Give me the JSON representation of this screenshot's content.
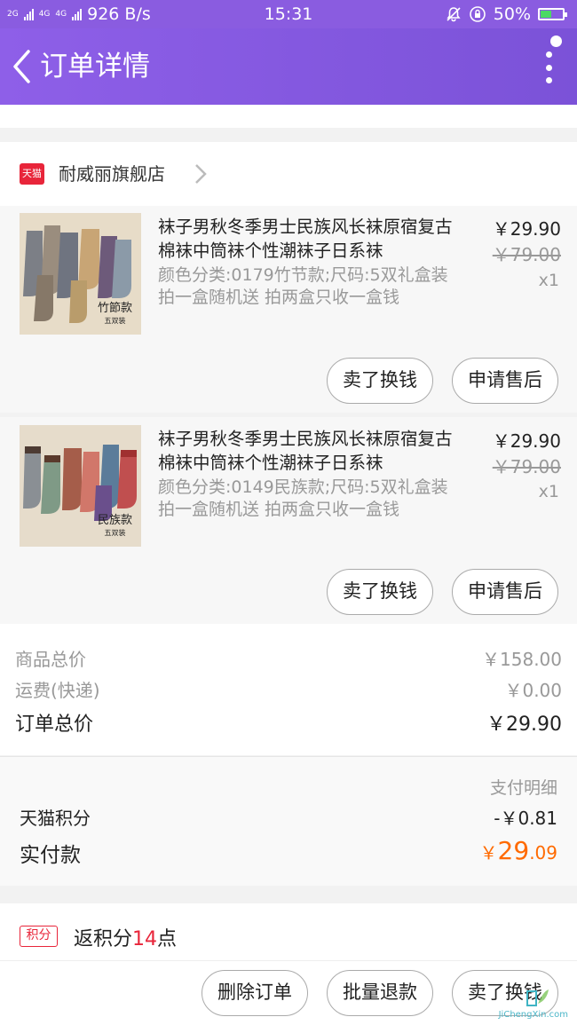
{
  "status": {
    "sig1": "2G",
    "sig2": "4G",
    "sig3": "4G",
    "speed": "926 B/s",
    "time": "15:31",
    "battery": "50%",
    "battery_level": 0.5
  },
  "header": {
    "title": "订单详情"
  },
  "shop": {
    "badge": "天猫",
    "name": "耐威丽旗舰店"
  },
  "items": [
    {
      "title": "袜子男秋冬季男士民族风长袜原宿复古棉袜中筒袜个性潮袜子日系袜",
      "spec": "颜色分类:0179竹节款;尺码:5双礼盒装 拍一盒随机送 拍两盒只收一盒钱",
      "price": "￥29.90",
      "original_price": "￥79.00",
      "qty": "x1",
      "thumb_label": "竹節款",
      "thumb_sub": "五双装",
      "btn_exchange": "卖了换钱",
      "btn_aftersale": "申请售后"
    },
    {
      "title": "袜子男秋冬季男士民族风长袜原宿复古棉袜中筒袜个性潮袜子日系袜",
      "spec": "颜色分类:0149民族款;尺码:5双礼盒装 拍一盒随机送 拍两盒只收一盒钱",
      "price": "￥29.90",
      "original_price": "￥79.00",
      "qty": "x1",
      "thumb_label": "民族款",
      "thumb_sub": "五双装",
      "btn_exchange": "卖了换钱",
      "btn_aftersale": "申请售后"
    }
  ],
  "summary": {
    "goods_label": "商品总价",
    "goods_value": "￥158.00",
    "shipping_label": "运费(快递)",
    "shipping_value": "￥0.00",
    "total_label": "订单总价",
    "total_value": "￥29.90"
  },
  "payment": {
    "detail_label": "支付明细",
    "points_label": "天猫积分",
    "points_value": "-￥0.81",
    "paid_label": "实付款",
    "paid_currency": "￥",
    "paid_int": "29",
    "paid_dec": ".09"
  },
  "rewards": {
    "tag": "积分",
    "text_prefix": "返积分",
    "points": "14",
    "text_suffix": "点"
  },
  "footer": {
    "delete": "删除订单",
    "batch_refund": "批量退款",
    "exchange": "卖了换钱"
  },
  "watermark": "JiChengXin.com",
  "colors": {
    "brand": "#8a5ce0",
    "accent_orange": "#ff6a00",
    "tmall_red": "#e8253a"
  }
}
